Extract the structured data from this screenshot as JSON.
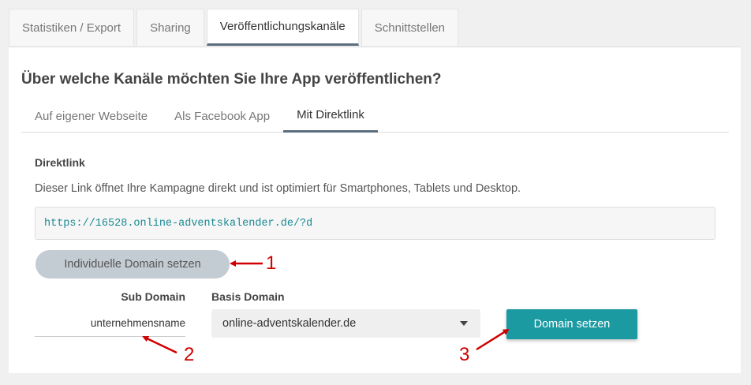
{
  "top_tabs": [
    {
      "label": "Statistiken / Export",
      "active": false
    },
    {
      "label": "Sharing",
      "active": false
    },
    {
      "label": "Veröffentlichungskanäle",
      "active": true
    },
    {
      "label": "Schnittstellen",
      "active": false
    }
  ],
  "heading": "Über welche Kanäle möchten Sie Ihre App veröffentlichen?",
  "sub_tabs": [
    {
      "label": "Auf eigener Webseite",
      "active": false
    },
    {
      "label": "Als Facebook App",
      "active": false
    },
    {
      "label": "Mit Direktlink",
      "active": true
    }
  ],
  "direktlink": {
    "title": "Direktlink",
    "description": "Dieser Link öffnet Ihre Kampagne direkt und ist optimiert für Smartphones, Tablets und Desktop.",
    "url": "https://16528.online-adventskalender.de/?d",
    "custom_domain_button": "Individuelle Domain setzen"
  },
  "domain_form": {
    "sub_domain_label": "Sub Domain",
    "sub_domain_value": "unternehmensname",
    "base_domain_label": "Basis Domain",
    "base_domain_selected": "online-adventskalender.de",
    "submit_label": "Domain setzen"
  },
  "annotations": {
    "one": "1",
    "two": "2",
    "three": "3"
  },
  "colors": {
    "accent": "#1c9aa2",
    "annotation": "#d10000",
    "tab_indicator": "#5b6c7b"
  }
}
